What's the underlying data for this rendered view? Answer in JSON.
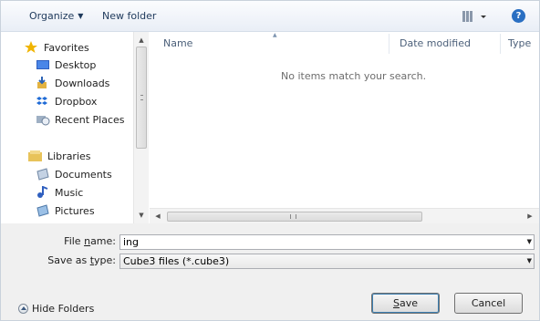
{
  "toolbar": {
    "organize_label": "Organize",
    "new_folder_label": "New folder",
    "view_icon": "view-options-icon",
    "help_icon": "help-icon",
    "help_glyph": "?"
  },
  "nav": {
    "items": [
      {
        "label": "Favorites",
        "icon": "star-icon"
      },
      {
        "label": "Desktop",
        "icon": "desktop-icon"
      },
      {
        "label": "Downloads",
        "icon": "downloads-icon"
      },
      {
        "label": "Dropbox",
        "icon": "dropbox-icon"
      },
      {
        "label": "Recent Places",
        "icon": "recent-places-icon"
      },
      {
        "label": "Libraries",
        "icon": "libraries-icon"
      },
      {
        "label": "Documents",
        "icon": "documents-icon"
      },
      {
        "label": "Music",
        "icon": "music-icon"
      },
      {
        "label": "Pictures",
        "icon": "pictures-icon"
      }
    ]
  },
  "file_list": {
    "columns": {
      "name": "Name",
      "date_modified": "Date modified",
      "type": "Type"
    },
    "empty_message": "No items match your search."
  },
  "form": {
    "file_name_label": "File name:",
    "file_name_label_pre": "File ",
    "file_name_label_key": "n",
    "file_name_label_post": "ame:",
    "file_name_value": "ing",
    "save_type_label": "Save as type:",
    "save_type_label_pre": "Save as ",
    "save_type_label_key": "t",
    "save_type_label_post": "ype:",
    "save_type_value": "Cube3 files (*.cube3)"
  },
  "footer": {
    "hide_folders_label": "Hide Folders",
    "save_label": "Save",
    "save_key": "S",
    "save_rest": "ave",
    "cancel_label": "Cancel"
  },
  "colors": {
    "toolbar_text": "#1e395b",
    "help_blue": "#2a6fc2",
    "column_header": "#4c607a"
  }
}
